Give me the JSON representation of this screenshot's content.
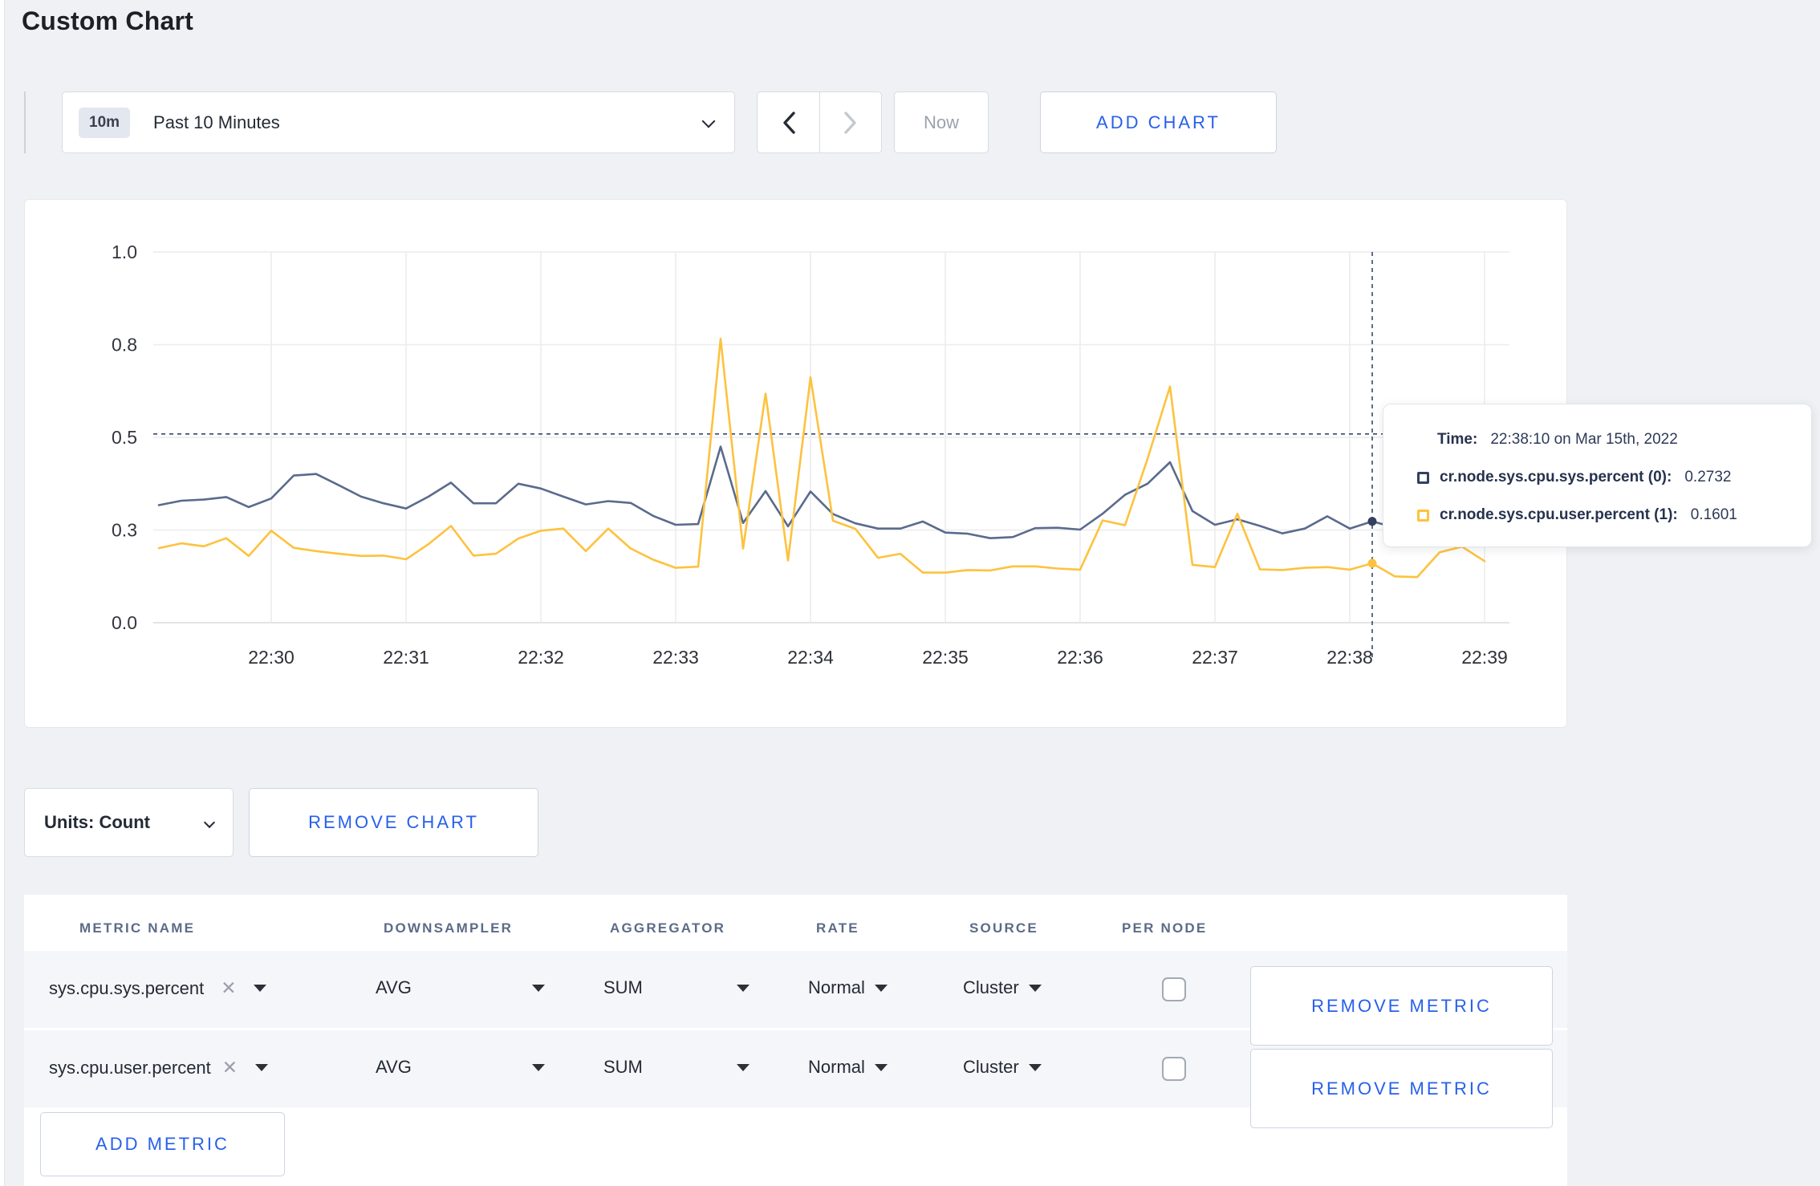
{
  "page_title": "Custom Chart",
  "toolbar": {
    "range_badge": "10m",
    "range_label": "Past 10 Minutes",
    "now_label": "Now",
    "add_chart_label": "ADD CHART"
  },
  "units": {
    "label": "Units: Count",
    "remove_chart_label": "REMOVE CHART"
  },
  "tooltip": {
    "time_label": "Time:",
    "time_value": "22:38:10 on Mar 15th, 2022",
    "series": [
      {
        "label": "cr.node.sys.cpu.sys.percent (0):",
        "value": "0.2732",
        "color": "#32415f"
      },
      {
        "label": "cr.node.sys.cpu.user.percent (1):",
        "value": "0.1601",
        "color": "#fdc23e"
      }
    ]
  },
  "chart_data": {
    "type": "line",
    "title": "",
    "xlabel": "",
    "ylabel": "",
    "ylim": [
      0,
      1
    ],
    "grid": true,
    "yticks": [
      {
        "v": 0.0,
        "label": "0.0"
      },
      {
        "v": 0.25,
        "label": "0.3"
      },
      {
        "v": 0.5,
        "label": "0.5"
      },
      {
        "v": 0.75,
        "label": "0.8"
      },
      {
        "v": 1.0,
        "label": "1.0"
      }
    ],
    "categories": [
      "22:30",
      "22:31",
      "22:32",
      "22:33",
      "22:34",
      "22:35",
      "22:36",
      "22:37",
      "22:38",
      "22:39"
    ],
    "x_tick_step_seconds": 60,
    "x_start_seconds": -50,
    "x_step_seconds": 10,
    "series": [
      {
        "name": "cr.node.sys.cpu.sys.percent",
        "color": "#5a6b8c",
        "values": [
          0.317,
          0.329,
          0.332,
          0.339,
          0.312,
          0.335,
          0.397,
          0.401,
          0.371,
          0.34,
          0.322,
          0.308,
          0.34,
          0.378,
          0.322,
          0.322,
          0.375,
          0.362,
          0.34,
          0.319,
          0.328,
          0.323,
          0.288,
          0.264,
          0.266,
          0.475,
          0.269,
          0.355,
          0.26,
          0.354,
          0.293,
          0.268,
          0.254,
          0.254,
          0.273,
          0.243,
          0.24,
          0.228,
          0.231,
          0.255,
          0.256,
          0.251,
          0.294,
          0.345,
          0.375,
          0.433,
          0.301,
          0.264,
          0.279,
          0.261,
          0.241,
          0.254,
          0.287,
          0.254,
          0.2732,
          0.257,
          0.262,
          0.27,
          0.255,
          0.26
        ]
      },
      {
        "name": "cr.node.sys.cpu.user.percent",
        "color": "#fdc23e",
        "values": [
          0.201,
          0.214,
          0.206,
          0.228,
          0.18,
          0.248,
          0.202,
          0.193,
          0.186,
          0.18,
          0.181,
          0.171,
          0.212,
          0.261,
          0.181,
          0.186,
          0.227,
          0.248,
          0.254,
          0.193,
          0.254,
          0.2,
          0.17,
          0.148,
          0.151,
          0.766,
          0.2,
          0.618,
          0.168,
          0.662,
          0.275,
          0.253,
          0.175,
          0.186,
          0.135,
          0.135,
          0.142,
          0.141,
          0.152,
          0.152,
          0.146,
          0.143,
          0.276,
          0.263,
          0.442,
          0.637,
          0.156,
          0.15,
          0.294,
          0.144,
          0.142,
          0.148,
          0.15,
          0.143,
          0.1601,
          0.125,
          0.123,
          0.19,
          0.205,
          0.166
        ]
      }
    ],
    "crosshair": {
      "time_seconds": 490,
      "value_y": 0.509
    },
    "markers": [
      {
        "series": 0,
        "time_seconds": 490,
        "value": 0.2732
      },
      {
        "series": 1,
        "time_seconds": 490,
        "value": 0.1601
      }
    ],
    "legend_position": "none"
  },
  "table": {
    "columns": [
      "METRIC NAME",
      "DOWNSAMPLER",
      "AGGREGATOR",
      "RATE",
      "SOURCE",
      "PER NODE"
    ],
    "rows": [
      {
        "metric": "sys.cpu.sys.percent",
        "downsampler": "AVG",
        "aggregator": "SUM",
        "rate": "Normal",
        "source": "Cluster",
        "per_node_checked": false,
        "remove_label": "REMOVE METRIC"
      },
      {
        "metric": "sys.cpu.user.percent",
        "downsampler": "AVG",
        "aggregator": "SUM",
        "rate": "Normal",
        "source": "Cluster",
        "per_node_checked": false,
        "remove_label": "REMOVE METRIC"
      }
    ],
    "add_metric_label": "ADD METRIC"
  }
}
